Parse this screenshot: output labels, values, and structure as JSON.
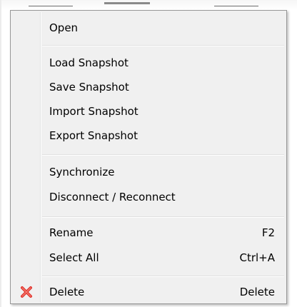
{
  "menu": {
    "items": [
      {
        "id": "open",
        "label": "Open",
        "shortcut": ""
      },
      {
        "id": "load-snapshot",
        "label": "Load Snapshot",
        "shortcut": ""
      },
      {
        "id": "save-snapshot",
        "label": "Save Snapshot",
        "shortcut": ""
      },
      {
        "id": "import-snapshot",
        "label": "Import Snapshot",
        "shortcut": ""
      },
      {
        "id": "export-snapshot",
        "label": "Export Snapshot",
        "shortcut": ""
      },
      {
        "id": "synchronize",
        "label": "Synchronize",
        "shortcut": ""
      },
      {
        "id": "disconnect-reconnect",
        "label": "Disconnect / Reconnect",
        "shortcut": ""
      },
      {
        "id": "rename",
        "label": "Rename",
        "shortcut": "F2"
      },
      {
        "id": "select-all",
        "label": "Select All",
        "shortcut": "Ctrl+A"
      },
      {
        "id": "delete",
        "label": "Delete",
        "shortcut": "Delete",
        "icon": "delete-x-icon"
      }
    ]
  },
  "colors": {
    "menu_background": "#f0f0f0",
    "menu_border": "#979797",
    "delete_icon": "#e0302a"
  }
}
